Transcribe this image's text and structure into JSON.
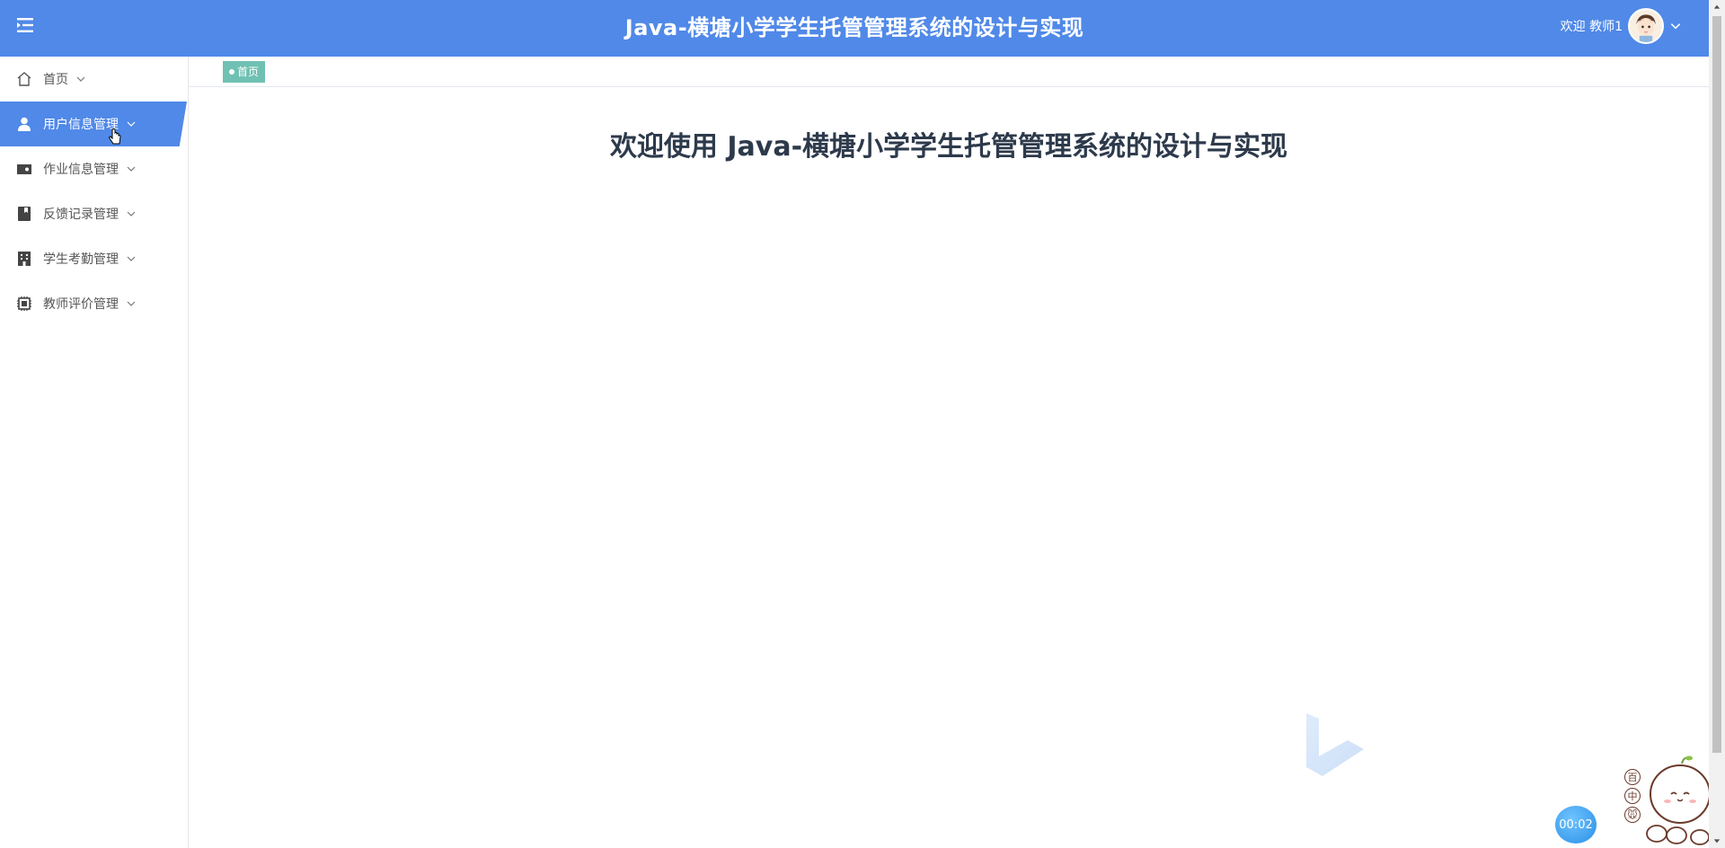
{
  "header": {
    "title": "Java-横塘小学学生托管管理系统的设计与实现",
    "user_label": "欢迎 教师1",
    "bg_color": "#5089e8"
  },
  "sidebar": {
    "items": [
      {
        "label": "首页",
        "icon": "home-icon"
      },
      {
        "label": "用户信息管理",
        "icon": "user-icon",
        "active": true
      },
      {
        "label": "作业信息管理",
        "icon": "wallet-icon"
      },
      {
        "label": "反馈记录管理",
        "icon": "bookmark-icon"
      },
      {
        "label": "学生考勤管理",
        "icon": "building-icon"
      },
      {
        "label": "教师评价管理",
        "icon": "chip-icon"
      }
    ]
  },
  "tags": [
    {
      "label": "首页"
    }
  ],
  "main": {
    "welcome": "欢迎使用 Java-横塘小学学生托管管理系统的设计与实现"
  },
  "widgets": {
    "timer": "00:02",
    "mascot_tools": [
      "百",
      "中",
      "🐭"
    ]
  }
}
